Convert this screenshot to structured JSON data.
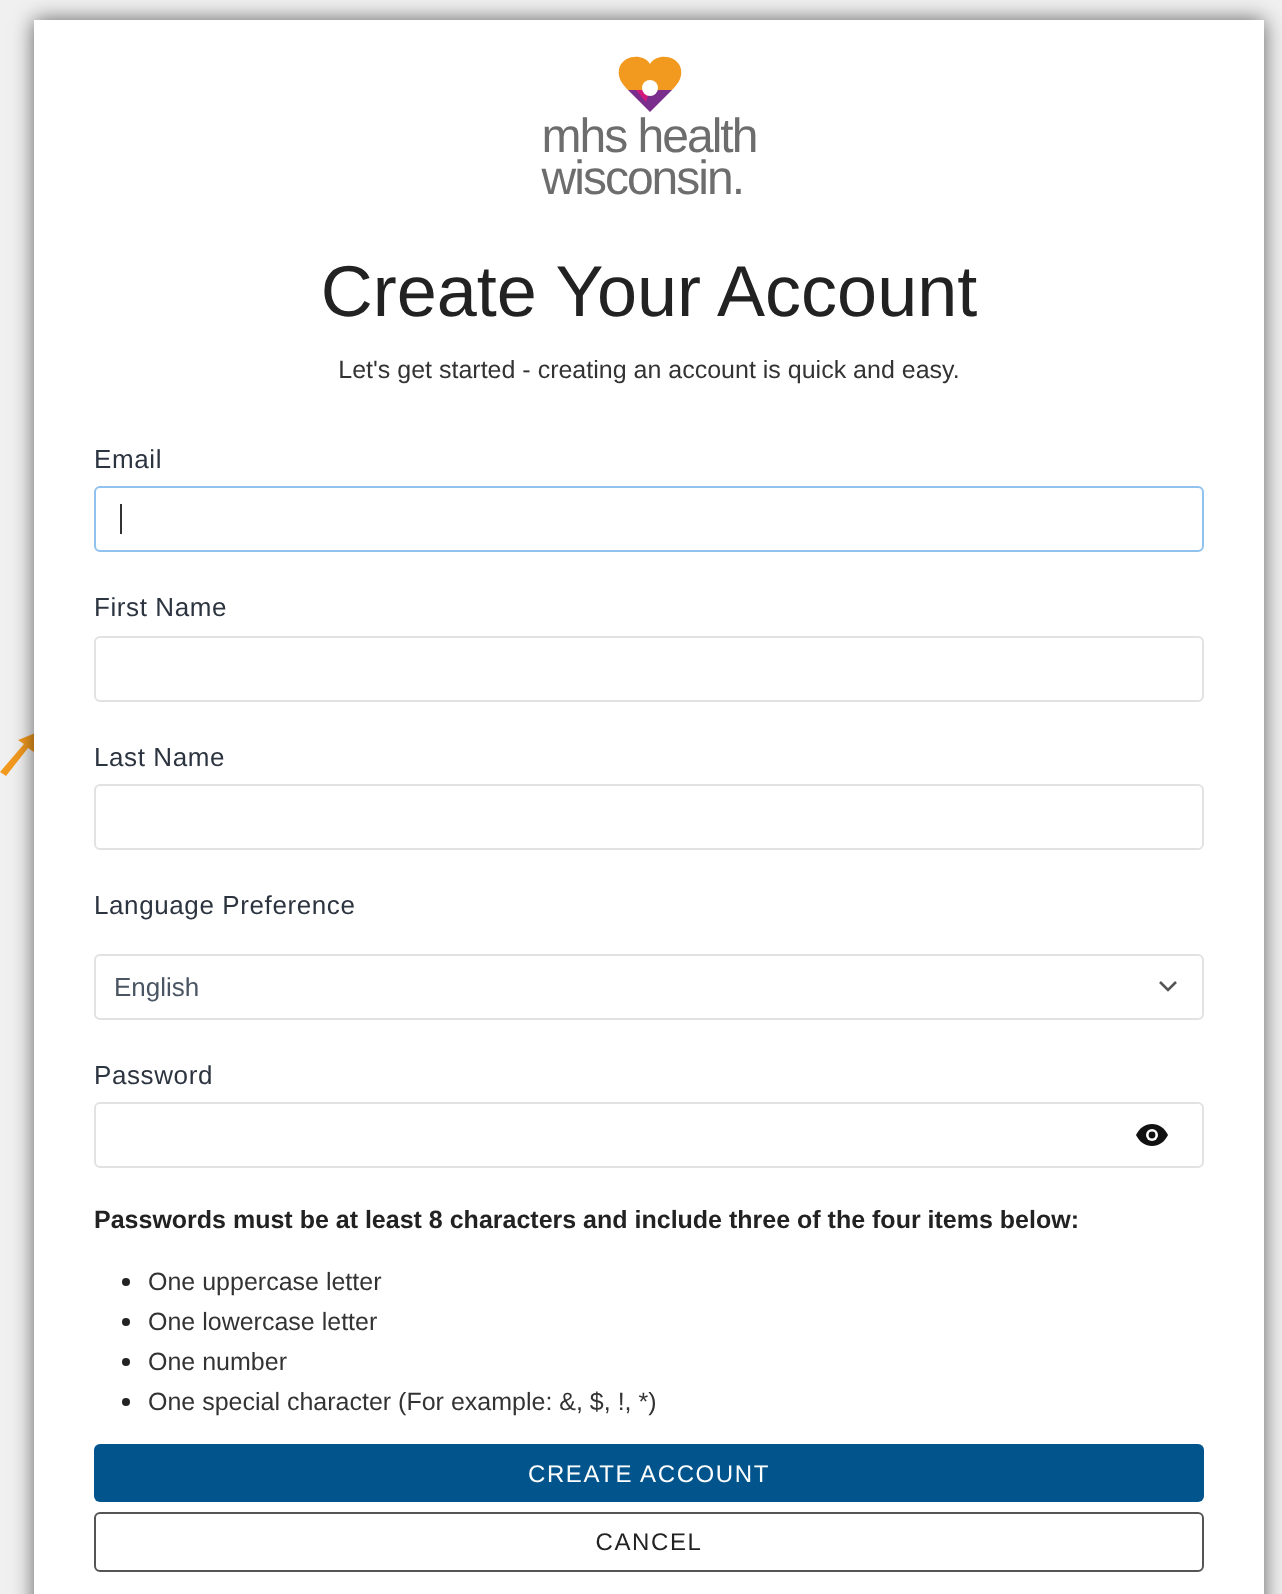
{
  "logo": {
    "line_1": "mhs health",
    "line_2": "wisconsin."
  },
  "title": "Create Your Account",
  "subtitle": "Let's get started - creating an account is quick and easy.",
  "fields": [
    {
      "kind": "text",
      "label": "Email",
      "focused": true
    },
    {
      "kind": "text",
      "label": "First Name",
      "focused": false
    },
    {
      "kind": "text",
      "label": "Last Name",
      "focused": false
    },
    {
      "kind": "select",
      "label": "Language Preference",
      "value": "English",
      "focused": false
    },
    {
      "kind": "password",
      "label": "Password",
      "focused": false
    }
  ],
  "rules": {
    "heading": "Passwords must be at least 8 characters and include three of the four items below:",
    "items": [
      "One uppercase letter",
      "One lowercase letter",
      "One number",
      "One special character (For example: &, $, !, *)"
    ]
  },
  "buttons": [
    {
      "kind": "primary",
      "label": "CREATE ACCOUNT"
    },
    {
      "kind": "secondary",
      "label": "CANCEL"
    }
  ]
}
